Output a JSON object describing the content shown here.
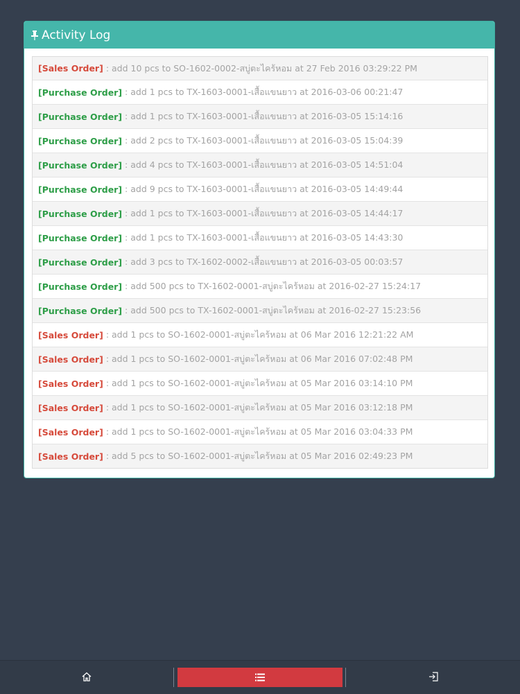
{
  "panel": {
    "title": "Activity Log",
    "header_color": "#45b6aa"
  },
  "logs": [
    {
      "type": "sales",
      "tag": "[Sales Order]",
      "text": ": add 10 pcs to SO-1602-0002-สบู่ตะไคร้หอม at 27 Feb 2016 03:29:22 PM"
    },
    {
      "type": "purchase",
      "tag": "[Purchase Order]",
      "text": ": add 1 pcs to TX-1603-0001-เสื้อแขนยาว at 2016-03-06 00:21:47"
    },
    {
      "type": "purchase",
      "tag": "[Purchase Order]",
      "text": ": add 1 pcs to TX-1603-0001-เสื้อแขนยาว at 2016-03-05 15:14:16"
    },
    {
      "type": "purchase",
      "tag": "[Purchase Order]",
      "text": ": add 2 pcs to TX-1603-0001-เสื้อแขนยาว at 2016-03-05 15:04:39"
    },
    {
      "type": "purchase",
      "tag": "[Purchase Order]",
      "text": ": add 4 pcs to TX-1603-0001-เสื้อแขนยาว at 2016-03-05 14:51:04"
    },
    {
      "type": "purchase",
      "tag": "[Purchase Order]",
      "text": ": add 9 pcs to TX-1603-0001-เสื้อแขนยาว at 2016-03-05 14:49:44"
    },
    {
      "type": "purchase",
      "tag": "[Purchase Order]",
      "text": ": add 1 pcs to TX-1603-0001-เสื้อแขนยาว at 2016-03-05 14:44:17"
    },
    {
      "type": "purchase",
      "tag": "[Purchase Order]",
      "text": ": add 1 pcs to TX-1603-0001-เสื้อแขนยาว at 2016-03-05 14:43:30"
    },
    {
      "type": "purchase",
      "tag": "[Purchase Order]",
      "text": ": add 3 pcs to TX-1602-0002-เสื้อแขนยาว at 2016-03-05 00:03:57"
    },
    {
      "type": "purchase",
      "tag": "[Purchase Order]",
      "text": ": add 500 pcs to TX-1602-0001-สบู่ตะไคร้หอม at 2016-02-27 15:24:17"
    },
    {
      "type": "purchase",
      "tag": "[Purchase Order]",
      "text": ": add 500 pcs to TX-1602-0001-สบู่ตะไคร้หอม at 2016-02-27 15:23:56"
    },
    {
      "type": "sales",
      "tag": "[Sales Order]",
      "text": ": add 1 pcs to SO-1602-0001-สบู่ตะไคร้หอม at 06 Mar 2016 12:21:22 AM"
    },
    {
      "type": "sales",
      "tag": "[Sales Order]",
      "text": ": add 1 pcs to SO-1602-0001-สบู่ตะไคร้หอม at 06 Mar 2016 07:02:48 PM"
    },
    {
      "type": "sales",
      "tag": "[Sales Order]",
      "text": ": add 1 pcs to SO-1602-0001-สบู่ตะไคร้หอม at 05 Mar 2016 03:14:10 PM"
    },
    {
      "type": "sales",
      "tag": "[Sales Order]",
      "text": ": add 1 pcs to SO-1602-0001-สบู่ตะไคร้หอม at 05 Mar 2016 03:12:18 PM"
    },
    {
      "type": "sales",
      "tag": "[Sales Order]",
      "text": ": add 1 pcs to SO-1602-0001-สบู่ตะไคร้หอม at 05 Mar 2016 03:04:33 PM"
    },
    {
      "type": "sales",
      "tag": "[Sales Order]",
      "text": ": add 5 pcs to SO-1602-0001-สบู่ตะไคร้หอม at 05 Mar 2016 02:49:23 PM"
    }
  ],
  "colors": {
    "sales": "#d64a3b",
    "purchase": "#2e9e48",
    "background": "#353f4e",
    "active_nav": "#d23a40"
  },
  "bottom_nav": {
    "home_icon": "home-icon",
    "list_icon": "list-icon",
    "logout_icon": "logout-icon"
  }
}
